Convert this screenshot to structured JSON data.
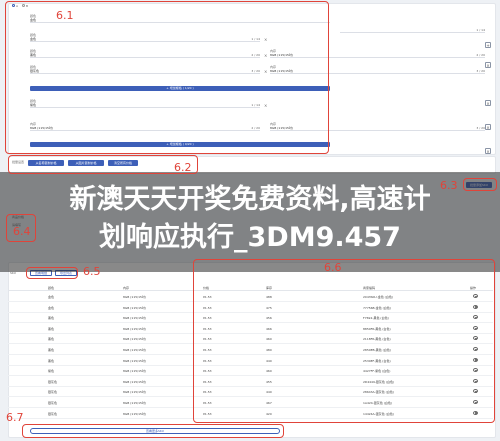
{
  "annotations": {
    "a61": "6.1",
    "a62": "6.2",
    "a63": "6.3",
    "a64": "6.4",
    "a65": "6.5",
    "a66": "6.6",
    "a67": "6.7"
  },
  "banner": {
    "line1": "新澳天天开奖免费资料,高速计",
    "line2": "划响应执行_3DM9.457"
  },
  "form": {
    "radio_a": "A",
    "radio_b": "B",
    "groups": [
      {
        "label": "颜色",
        "value": "金色",
        "counter": "1 / 14",
        "close": "×"
      },
      {
        "label": "颜色",
        "value": "黑色",
        "counter": "2 / 20",
        "close": "×"
      },
      {
        "label": "颜色",
        "value": "银灰色",
        "counter": "3 / 20",
        "close": "×"
      },
      {
        "label": "颜色",
        "value": "紫色",
        "counter": "1 / 14",
        "close": "×"
      }
    ],
    "sub_fields": [
      {
        "label": "内存",
        "value": "8GB (115/15吋)",
        "counter": "2 / 20"
      },
      {
        "label": "内存",
        "value": "8GB (115/15吋)",
        "counter": "3 / 20"
      }
    ],
    "add_button_1": "+ 增加规格 ( 1/20 )",
    "add_button_2": "+ 增加规格 ( 0/20 )",
    "side_plus": "+",
    "side_close": "×"
  },
  "toolbar": {
    "label": "批量设置",
    "btn1": "从名称复制价格",
    "btn2": "从图片复制价格",
    "btn3": "清空所有价格",
    "generate": "批量添加SKU"
  },
  "table_toolbar": {
    "label": "SKU",
    "btn1": "查看明细",
    "btn2": "导出列表"
  },
  "left_note": {
    "l1": "商品价格",
    "l2": "请填写"
  },
  "table": {
    "headers": [
      "颜色",
      "内存",
      "价格",
      "库存",
      "商家编码",
      "操作"
    ],
    "rows": [
      [
        "金色",
        "8GB (115/15吋)",
        "¥1.53",
        "488",
        "2043SKU-金色 (白色)"
      ],
      [
        "金色",
        "8GB (115/15吋)",
        "¥1.53",
        "475",
        "77756B-金色 (白色)"
      ],
      [
        "黑色",
        "8GB (115/15吋)",
        "¥1.53",
        "456",
        "F7692-黑色 (白色)"
      ],
      [
        "黑色",
        "8GB (115/15吋)",
        "¥1.53",
        "466",
        "8850FR-黑色 (白色)"
      ],
      [
        "黑色",
        "8GB (115/15吋)",
        "¥1.53",
        "460",
        "2118FR-黑色 (白色)"
      ],
      [
        "黑色",
        "8GB (115/15吋)",
        "¥1.53",
        "480",
        "2850EB-黑色 (白色)"
      ],
      [
        "黑色",
        "8GB (115/15吋)",
        "¥1.53",
        "440",
        "2530EF-黑色 (白色)"
      ],
      [
        "紫色",
        "8GB (115/15吋)",
        "¥1.53",
        "460",
        "4427FF-紫色 (白色)"
      ],
      [
        "银灰色",
        "8GB (115/15吋)",
        "¥1.53",
        "455",
        "2D4449-银灰色 (白色)"
      ],
      [
        "银灰色",
        "8GB (115/15吋)",
        "¥1.53",
        "440",
        "28643A-银灰色 (白色)"
      ],
      [
        "银灰色",
        "8GB (115/15吋)",
        "¥1.53",
        "467",
        "1A424-银灰色 (白色)"
      ],
      [
        "银灰色",
        "8GB (115/15吋)",
        "¥1.53",
        "420",
        "14424A-银灰色 (白色)"
      ]
    ]
  },
  "footer": {
    "btn": "查看更多SKU"
  },
  "colors": {
    "accent": "#3d5fb8",
    "annotation": "#e0443a"
  }
}
